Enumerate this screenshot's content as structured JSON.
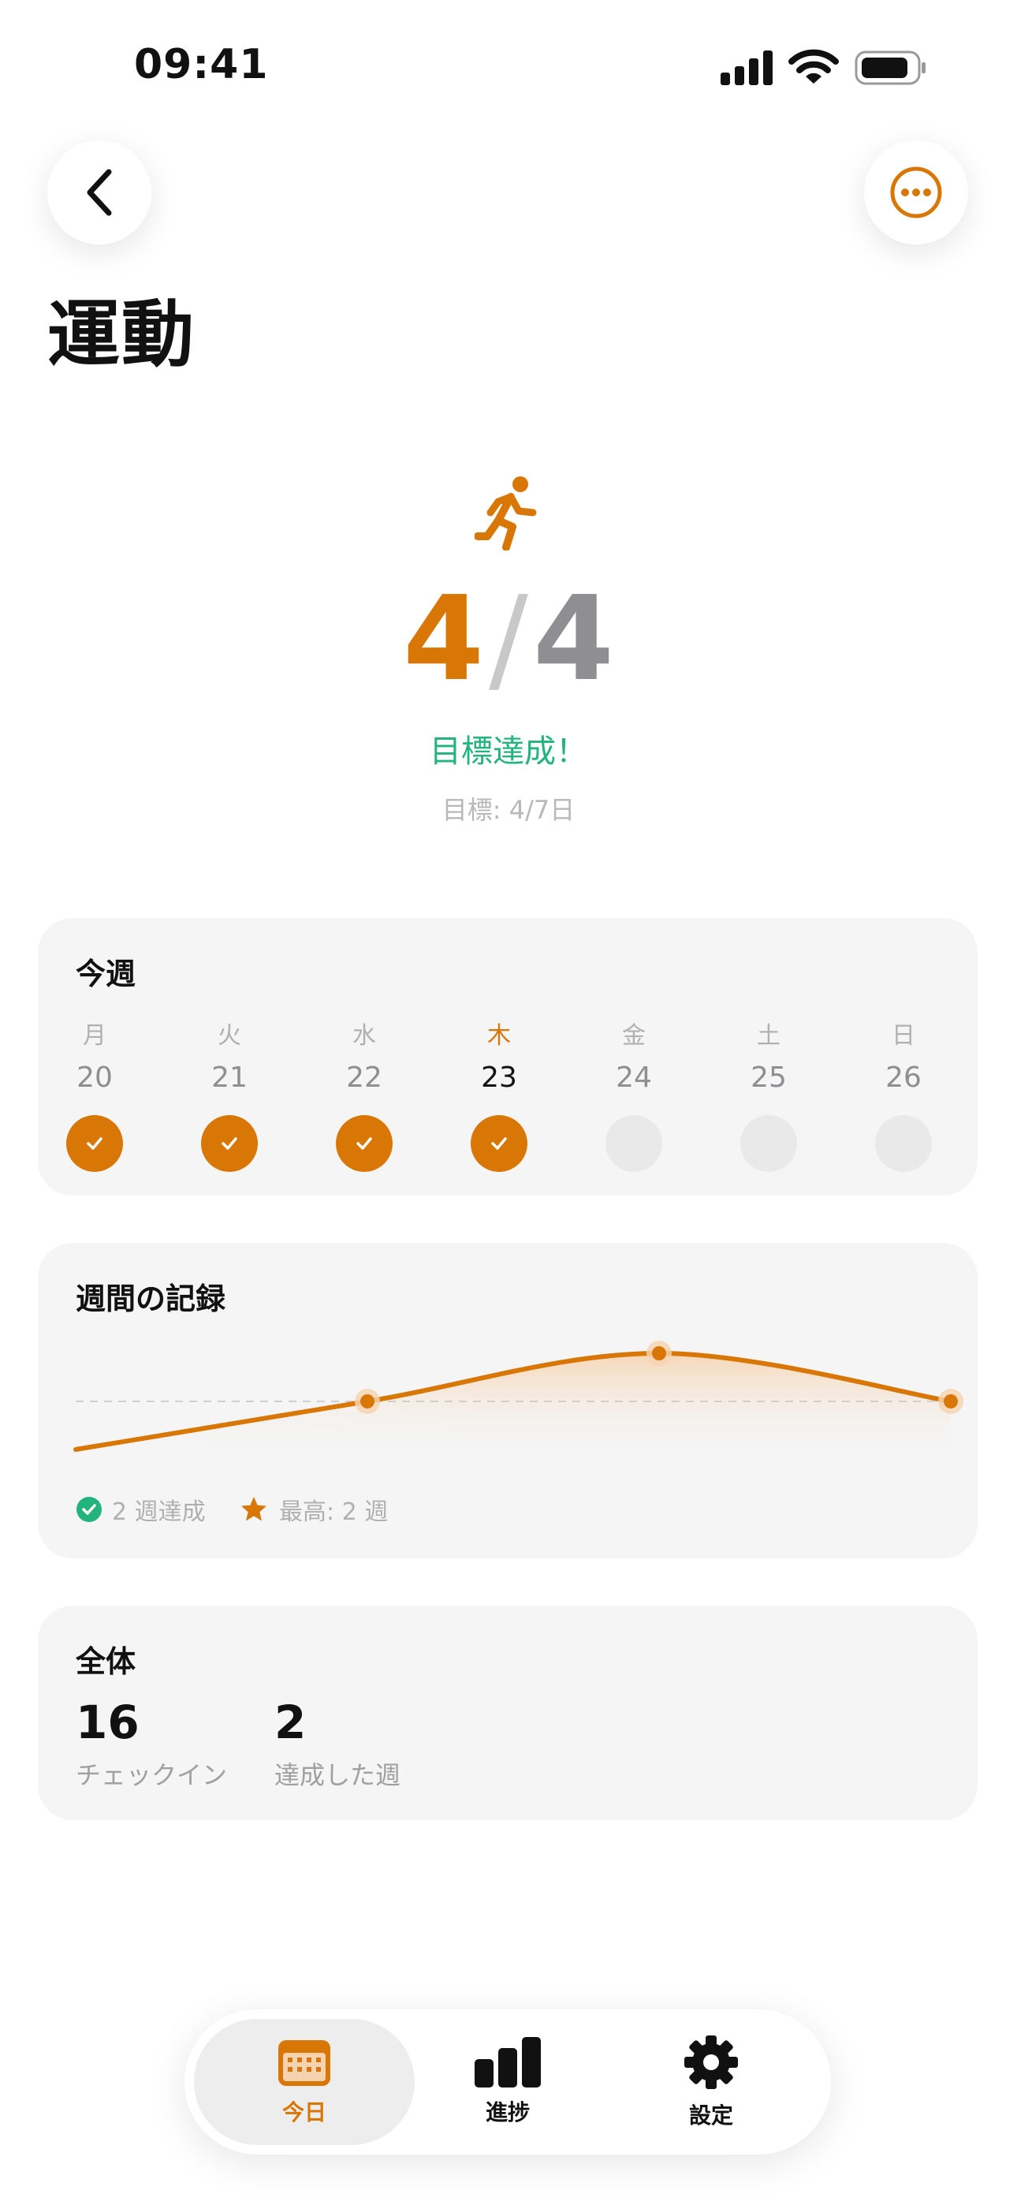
{
  "status_bar": {
    "time": "09:41"
  },
  "header": {
    "title": "運動",
    "back_icon": "chevron-left-icon",
    "more_icon": "ellipsis-circle-icon"
  },
  "hero": {
    "icon": "running-figure-icon",
    "done": "4",
    "slash": "/",
    "total": "4",
    "message": "目標達成！",
    "goal": "目標: 4/7日"
  },
  "this_week": {
    "title": "今週",
    "days": [
      {
        "name": "月",
        "date": "20",
        "checked": true,
        "today": false
      },
      {
        "name": "火",
        "date": "21",
        "checked": true,
        "today": false
      },
      {
        "name": "水",
        "date": "22",
        "checked": true,
        "today": false
      },
      {
        "name": "木",
        "date": "23",
        "checked": true,
        "today": true
      },
      {
        "name": "金",
        "date": "24",
        "checked": false,
        "today": false
      },
      {
        "name": "土",
        "date": "25",
        "checked": false,
        "today": false
      },
      {
        "name": "日",
        "date": "26",
        "checked": false,
        "today": false
      }
    ]
  },
  "weekly_record": {
    "title": "週間の記録",
    "legend_achieved": "2 週達成",
    "legend_best": "最高: 2 週"
  },
  "chart_data": {
    "type": "line",
    "x": [
      1,
      2,
      3,
      4
    ],
    "values": [
      0,
      1,
      2,
      1
    ],
    "goal_line": 1,
    "ylim": [
      0,
      2
    ],
    "markers_from_index": 1,
    "series_color": "#D97706",
    "grid": false
  },
  "overall": {
    "title": "全体",
    "stats": [
      {
        "value": "16",
        "label": "チェックイン"
      },
      {
        "value": "2",
        "label": "達成した週"
      }
    ]
  },
  "tabbar": {
    "tabs": [
      {
        "label": "今日",
        "icon": "calendar-icon",
        "active": true
      },
      {
        "label": "進捗",
        "icon": "bar-chart-icon",
        "active": false
      },
      {
        "label": "設定",
        "icon": "gear-icon",
        "active": false
      }
    ]
  },
  "colors": {
    "accent": "#D97706",
    "success": "#22B47C",
    "card_bg": "#F5F5F5"
  }
}
